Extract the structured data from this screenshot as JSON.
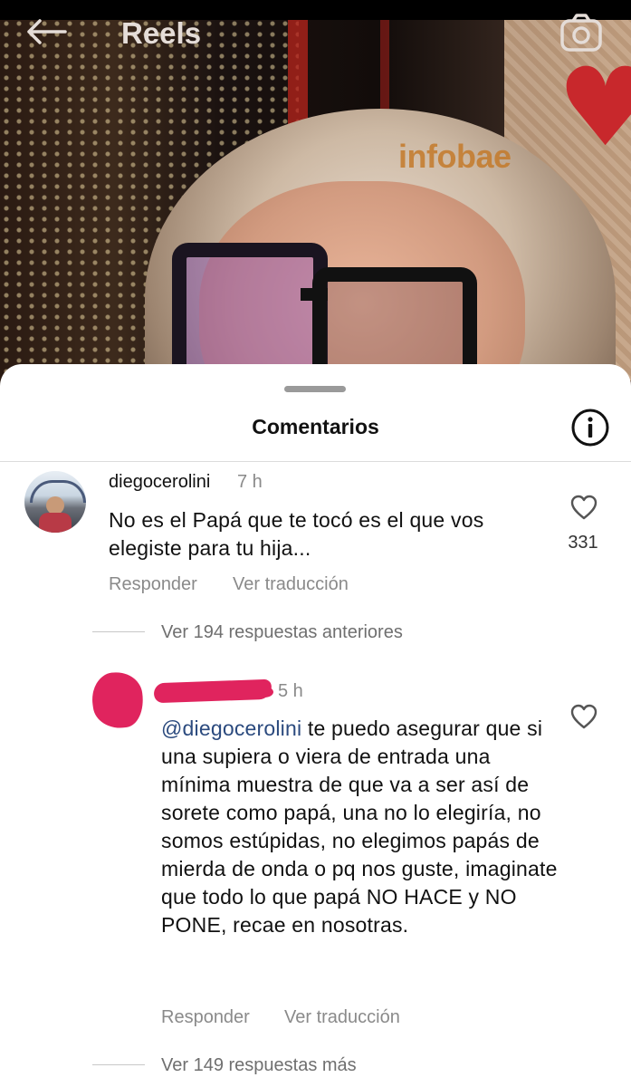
{
  "header": {
    "title": "Reels",
    "back_icon": "arrow-left-icon",
    "camera_icon": "camera-icon",
    "watermark": "infobae"
  },
  "sheet": {
    "title": "Comentarios",
    "info_icon": "info-icon"
  },
  "comments": [
    {
      "username": "diegocerolini",
      "time": "7 h",
      "text": "No es el Papá que te tocó es el que vos elegiste para tu hija...",
      "likes": "331",
      "reply_label": "Responder",
      "translate_label": "Ver traducción",
      "view_replies": "Ver 194 respuestas anteriores"
    },
    {
      "username": "",
      "time": "5 h",
      "mention": "@diegocerolini",
      "text": " te puedo asegurar que si una supiera o viera de entrada una mínima muestra de que va a ser así de sorete como papá, una no lo elegiría, no somos estúpidas, no elegimos papás de mierda de onda o pq nos guste, imaginate que todo lo que papá NO HACE y NO PONE, recae en nosotras.",
      "reply_label": "Responder",
      "translate_label": "Ver traducción",
      "view_replies": "Ver 149 respuestas más"
    }
  ],
  "colors": {
    "mention": "#2b4a7e",
    "redaction": "#e0245e",
    "muted_text": "#8a8a8a"
  }
}
